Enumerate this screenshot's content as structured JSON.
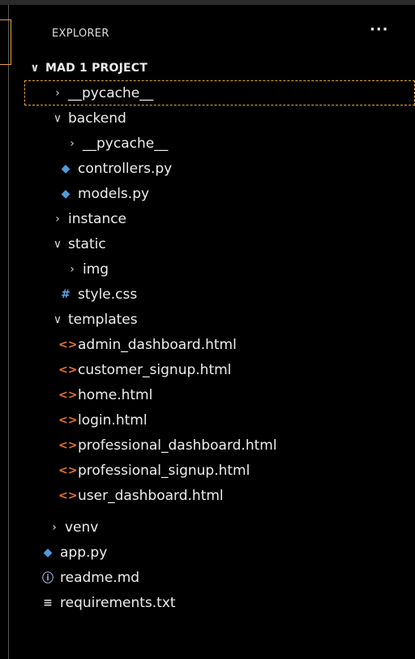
{
  "explorer": {
    "title": "EXPLORER",
    "more": "···"
  },
  "root": {
    "label": "MAD 1 PROJECT",
    "twisty": "∨"
  },
  "tree": [
    {
      "label": "__pycache__",
      "twisty": "›",
      "icon": "",
      "icon_name": "folder-collapsed"
    },
    {
      "label": "backend",
      "twisty": "∨",
      "icon": "",
      "icon_name": "folder-expanded"
    },
    {
      "label": "__pycache__",
      "twisty": "›",
      "icon": "",
      "icon_name": "folder-collapsed"
    },
    {
      "label": "controllers.py",
      "twisty": "",
      "icon": "◆",
      "icon_name": "python-icon"
    },
    {
      "label": "models.py",
      "twisty": "",
      "icon": "◆",
      "icon_name": "python-icon"
    },
    {
      "label": "instance",
      "twisty": "›",
      "icon": "",
      "icon_name": "folder-collapsed"
    },
    {
      "label": "static",
      "twisty": "∨",
      "icon": "",
      "icon_name": "folder-expanded"
    },
    {
      "label": "img",
      "twisty": "›",
      "icon": "",
      "icon_name": "folder-collapsed"
    },
    {
      "label": "style.css",
      "twisty": "",
      "icon": "#",
      "icon_name": "css-icon"
    },
    {
      "label": "templates",
      "twisty": "∨",
      "icon": "",
      "icon_name": "folder-expanded"
    },
    {
      "label": "admin_dashboard.html",
      "twisty": "",
      "icon": "<>",
      "icon_name": "html-icon"
    },
    {
      "label": "customer_signup.html",
      "twisty": "",
      "icon": "<>",
      "icon_name": "html-icon"
    },
    {
      "label": "home.html",
      "twisty": "",
      "icon": "<>",
      "icon_name": "html-icon"
    },
    {
      "label": "login.html",
      "twisty": "",
      "icon": "<>",
      "icon_name": "html-icon"
    },
    {
      "label": "professional_dashboard.html",
      "twisty": "",
      "icon": "<>",
      "icon_name": "html-icon"
    },
    {
      "label": "professional_signup.html",
      "twisty": "",
      "icon": "<>",
      "icon_name": "html-icon"
    },
    {
      "label": "user_dashboard.html",
      "twisty": "",
      "icon": "<>",
      "icon_name": "html-icon"
    },
    {
      "label": "venv",
      "twisty": "›",
      "icon": "",
      "icon_name": "folder-collapsed"
    },
    {
      "label": "app.py",
      "twisty": "",
      "icon": "◆",
      "icon_name": "python-icon"
    },
    {
      "label": "readme.md",
      "twisty": "",
      "icon": "ⓘ",
      "icon_name": "info-icon"
    },
    {
      "label": "requirements.txt",
      "twisty": "",
      "icon": "≡",
      "icon_name": "text-file-icon"
    }
  ],
  "colors": {
    "background": "#000000",
    "focus_outline": "#e8a33d",
    "python": "#4f9be0",
    "html": "#e8732a",
    "css": "#5aa0e6",
    "text": "#ededed"
  }
}
